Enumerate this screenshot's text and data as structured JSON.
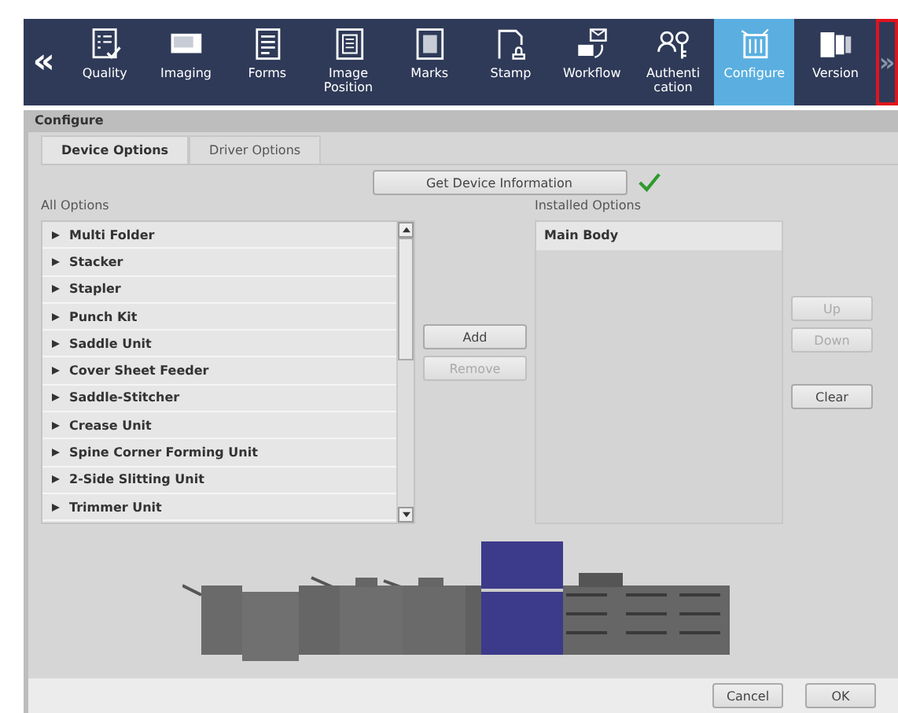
{
  "toolbar": {
    "prev": {
      "label": "«"
    },
    "next": {
      "label": "»",
      "highlighted": true
    },
    "items": [
      {
        "label": "Quality",
        "selected": false
      },
      {
        "label": "Imaging",
        "selected": false
      },
      {
        "label": "Forms",
        "selected": false
      },
      {
        "label": "Image Position",
        "selected": false
      },
      {
        "label": "Marks",
        "selected": false
      },
      {
        "label": "Stamp",
        "selected": false
      },
      {
        "label": "Workflow",
        "selected": false
      },
      {
        "label": "Authenti\ncation",
        "selected": false
      },
      {
        "label": "Configure",
        "selected": true
      },
      {
        "label": "Version",
        "selected": false
      }
    ]
  },
  "panel": {
    "title": "Configure",
    "tabs": [
      {
        "label": "Device Options",
        "selected": true
      },
      {
        "label": "Driver Options",
        "selected": false
      }
    ],
    "get_info": {
      "label": "Get Device Information",
      "confirmed": true
    },
    "all_options": {
      "label": "All Options",
      "items": [
        {
          "label": "Multi Folder"
        },
        {
          "label": "Stacker"
        },
        {
          "label": "Stapler"
        },
        {
          "label": "Punch Kit"
        },
        {
          "label": "Saddle Unit"
        },
        {
          "label": "Cover Sheet Feeder"
        },
        {
          "label": "Saddle-Stitcher"
        },
        {
          "label": "Crease Unit"
        },
        {
          "label": "Spine Corner Forming Unit"
        },
        {
          "label": "2-Side Slitting Unit"
        },
        {
          "label": "Trimmer Unit"
        }
      ]
    },
    "middle_buttons": [
      {
        "label": "Add",
        "disabled": false
      },
      {
        "label": "Remove",
        "disabled": true
      }
    ],
    "installed_options": {
      "label": "Installed Options",
      "items": [
        {
          "label": "Main Body"
        }
      ]
    },
    "side_buttons": [
      {
        "label": "Up",
        "disabled": true
      },
      {
        "label": "Down",
        "disabled": true
      },
      {
        "label": "Clear",
        "disabled": false
      }
    ]
  },
  "footer": {
    "buttons": [
      {
        "label": "Cancel"
      },
      {
        "label": "OK"
      }
    ]
  }
}
